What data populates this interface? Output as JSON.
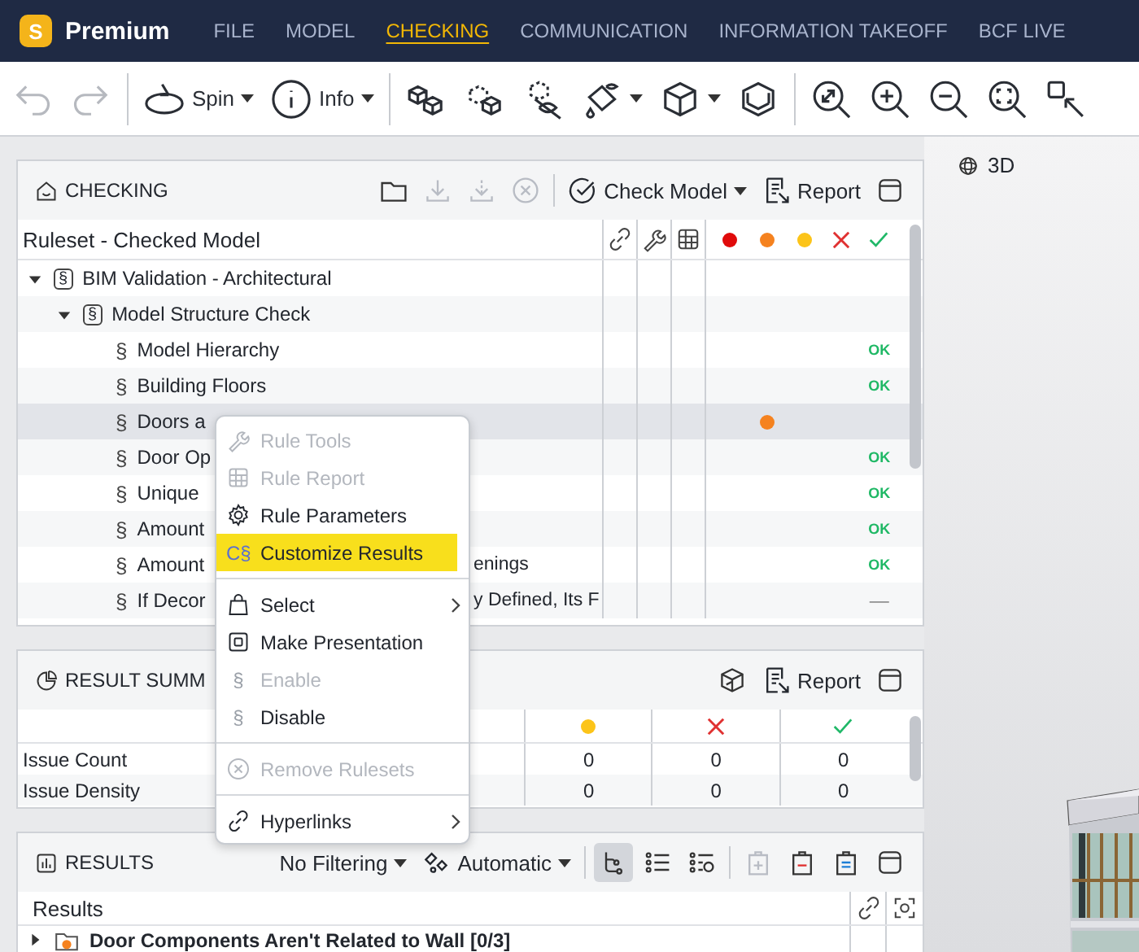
{
  "app": {
    "logo": "S",
    "name": "Premium"
  },
  "menu": [
    {
      "label": "FILE",
      "selected": false
    },
    {
      "label": "MODEL",
      "selected": false
    },
    {
      "label": "CHECKING",
      "selected": true
    },
    {
      "label": "COMMUNICATION",
      "selected": false
    },
    {
      "label": "INFORMATION TAKEOFF",
      "selected": false
    },
    {
      "label": "BCF LIVE",
      "selected": false
    }
  ],
  "toolbar": [
    {
      "kind": "undo",
      "disabled": true
    },
    {
      "kind": "redo",
      "disabled": true
    },
    {
      "kind": "sep"
    },
    {
      "kind": "spin",
      "label": "Spin",
      "dropdown": true
    },
    {
      "kind": "info",
      "label": "Info",
      "dropdown": true
    },
    {
      "kind": "sep"
    },
    {
      "kind": "cubes"
    },
    {
      "kind": "isolate"
    },
    {
      "kind": "hide"
    },
    {
      "kind": "paint",
      "dropdown": true
    },
    {
      "kind": "box",
      "dropdown": true
    },
    {
      "kind": "section"
    },
    {
      "kind": "sep"
    },
    {
      "kind": "zoom-extent"
    },
    {
      "kind": "zoom-in"
    },
    {
      "kind": "zoom-out"
    },
    {
      "kind": "zoom-fit"
    },
    {
      "kind": "select-arrow"
    }
  ],
  "checking": {
    "title": "CHECKING",
    "actions": [
      {
        "kind": "folder",
        "disabled": false
      },
      {
        "kind": "download",
        "disabled": true
      },
      {
        "kind": "download-dashed",
        "disabled": true
      },
      {
        "kind": "cancel",
        "disabled": true
      }
    ],
    "check_button": "Check Model",
    "report_button": "Report",
    "column_header": "Ruleset - Checked Model",
    "status_columns": [
      {
        "kind": "dot",
        "color": "#e00b0b"
      },
      {
        "kind": "dot",
        "color": "#f5821f"
      },
      {
        "kind": "dot",
        "color": "#fcc419"
      },
      {
        "kind": "cross"
      },
      {
        "kind": "check"
      }
    ],
    "tree": [
      {
        "kind": "ruleset",
        "icon": "§",
        "name": "BIM Validation - Architectural",
        "expanded": true,
        "children": [
          {
            "kind": "ruleset",
            "icon": "§",
            "name": "Model Structure Check",
            "expanded": true,
            "children": [
              {
                "kind": "rule",
                "icon": "§",
                "name": "Model Hierarchy",
                "selected": false,
                "result": {
                  "kind": "pass",
                  "text": "OK"
                }
              },
              {
                "kind": "rule",
                "icon": "§",
                "name": "Building Floors",
                "selected": false,
                "result": {
                  "kind": "pass",
                  "text": "OK"
                }
              },
              {
                "kind": "rule",
                "icon": "§",
                "name": "Doors a",
                "selected": true,
                "result": {
                  "kind": "issue",
                  "color": "#f5821f"
                }
              },
              {
                "kind": "rule",
                "icon": "§",
                "name": "Door Op",
                "selected": false,
                "result": {
                  "kind": "pass",
                  "text": "OK"
                }
              },
              {
                "kind": "rule",
                "icon": "§",
                "name": "Unique",
                "selected": false,
                "result": {
                  "kind": "pass",
                  "text": "OK"
                }
              },
              {
                "kind": "rule",
                "icon": "§",
                "name": "Amount",
                "selected": false,
                "result": {
                  "kind": "pass",
                  "text": "OK"
                }
              },
              {
                "kind": "rule",
                "icon": "§",
                "name": "Amount",
                "tail": "enings",
                "selected": false,
                "result": {
                  "kind": "pass",
                  "text": "OK"
                }
              },
              {
                "kind": "rule",
                "icon": "§",
                "name": "If Decor",
                "tail": "y Defined, Its F",
                "selected": false,
                "result": {
                  "kind": "unchecked",
                  "text": "—"
                }
              }
            ]
          }
        ]
      }
    ]
  },
  "summary": {
    "title": "RESULT SUMM",
    "report_button": "Report",
    "columns": [
      {
        "kind": "dot",
        "color": "#fcc419"
      },
      {
        "kind": "cross"
      },
      {
        "kind": "check"
      }
    ],
    "rows": [
      {
        "label": "Issue Count",
        "values": [
          "0",
          "0",
          "0"
        ]
      },
      {
        "label": "Issue Density",
        "values": [
          "0",
          "0",
          "0"
        ]
      }
    ]
  },
  "results": {
    "title": "RESULTS",
    "filter": "No Filtering",
    "mode": "Automatic",
    "views": [
      {
        "kind": "tree",
        "selected": true
      },
      {
        "kind": "list",
        "selected": false
      },
      {
        "kind": "list-settings",
        "selected": false
      }
    ],
    "actions": [
      {
        "kind": "add",
        "disabled": true
      },
      {
        "kind": "remove",
        "disabled": false
      },
      {
        "kind": "note",
        "disabled": false
      }
    ],
    "column_header": "Results",
    "rows": [
      {
        "name": "Door Components Aren't Related to Wall [0/3]",
        "expanded": false
      }
    ]
  },
  "context_menu": [
    {
      "kind": "item",
      "label": "Rule Tools",
      "disabled": true,
      "selected": false
    },
    {
      "kind": "item",
      "label": "Rule Report",
      "disabled": true,
      "selected": false
    },
    {
      "kind": "item",
      "label": "Rule Parameters",
      "disabled": false,
      "selected": false
    },
    {
      "kind": "item",
      "icon_text": "C§",
      "label": "Customize Results",
      "disabled": false,
      "selected": true
    },
    {
      "kind": "separator"
    },
    {
      "kind": "item",
      "label": "Select",
      "disabled": false,
      "selected": false,
      "submenu": true
    },
    {
      "kind": "item",
      "label": "Make Presentation",
      "disabled": false,
      "selected": false
    },
    {
      "kind": "item",
      "icon_text": "§",
      "label": "Enable",
      "disabled": true,
      "selected": false
    },
    {
      "kind": "item",
      "icon_text": "§",
      "label": "Disable",
      "disabled": false,
      "selected": false
    },
    {
      "kind": "separator"
    },
    {
      "kind": "item",
      "label": "Remove Rulesets",
      "disabled": true,
      "selected": false
    },
    {
      "kind": "separator"
    },
    {
      "kind": "item",
      "label": "Hyperlinks",
      "disabled": false,
      "selected": false,
      "submenu": true
    }
  ],
  "view": {
    "label": "3D"
  }
}
